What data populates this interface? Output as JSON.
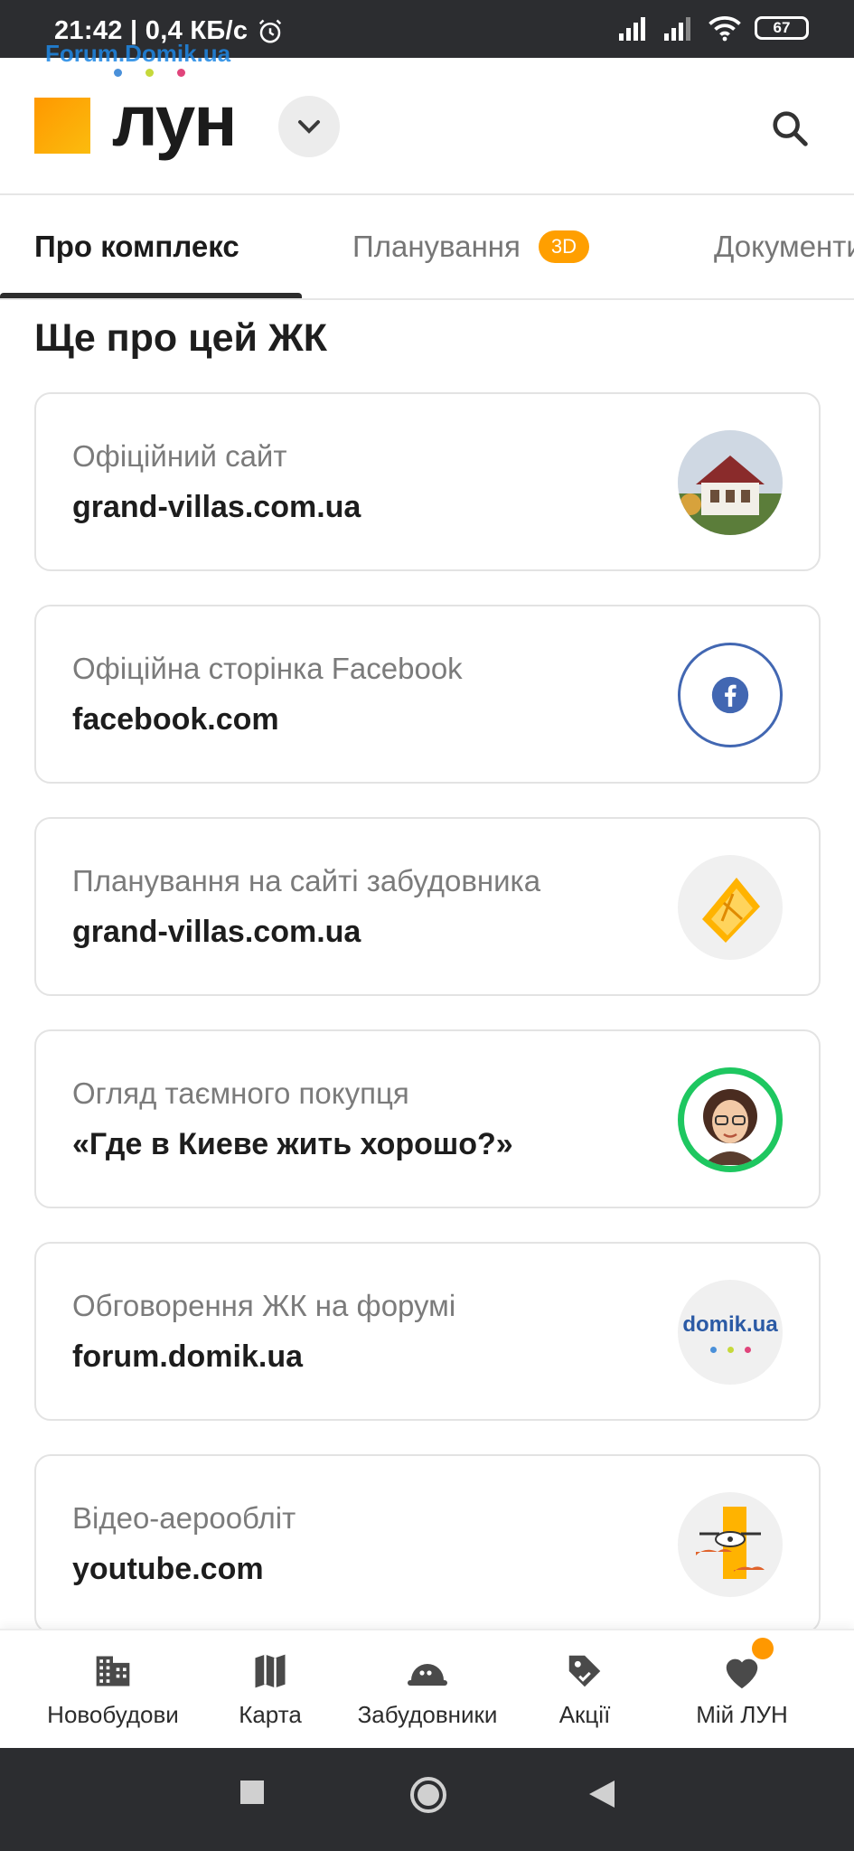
{
  "status_bar": {
    "time_and_speed": "21:42 | 0,4 КБ/с",
    "battery": "67"
  },
  "watermark": {
    "text": "Forum.Domik.ua",
    "dot_colors": [
      "#4a90d9",
      "#c6d93b",
      "#e0457b"
    ]
  },
  "header": {
    "logo_text": "лун"
  },
  "tabs": [
    {
      "label": "Про комплекс",
      "active": true
    },
    {
      "label": "Планування",
      "badge": "3D"
    },
    {
      "label": "Документи"
    }
  ],
  "section": {
    "title": "Ще про цей ЖК"
  },
  "cards": [
    {
      "label": "Офіційний сайт",
      "value": "grand-villas.com.ua",
      "thumb": "house-photo"
    },
    {
      "label": "Офіційна сторінка Facebook",
      "value": "facebook.com",
      "thumb": "facebook-icon"
    },
    {
      "label": "Планування на сайті забудовника",
      "value": "grand-villas.com.ua",
      "thumb": "floorplan-icon"
    },
    {
      "label": "Огляд таємного покупця",
      "value": "«Где в Киеве жить хорошо?»",
      "thumb": "avatar-icon"
    },
    {
      "label": "Обговорення ЖК на форумі",
      "value": "forum.domik.ua",
      "thumb": "domik-logo",
      "thumb_text": "domik.ua"
    },
    {
      "label": "Відео-аерообліт",
      "value": "youtube.com",
      "thumb": "drone-icon"
    }
  ],
  "bottom_nav": [
    {
      "label": "Новобудови",
      "icon": "buildings-icon"
    },
    {
      "label": "Карта",
      "icon": "map-icon"
    },
    {
      "label": "Забудовники",
      "icon": "hardhat-icon"
    },
    {
      "label": "Акції",
      "icon": "tag-icon"
    },
    {
      "label": "Мій ЛУН",
      "icon": "heart-icon"
    }
  ],
  "colors": {
    "accent": "#ff9f00",
    "facebook": "#4267b2",
    "avatar_ring": "#1ec760"
  }
}
